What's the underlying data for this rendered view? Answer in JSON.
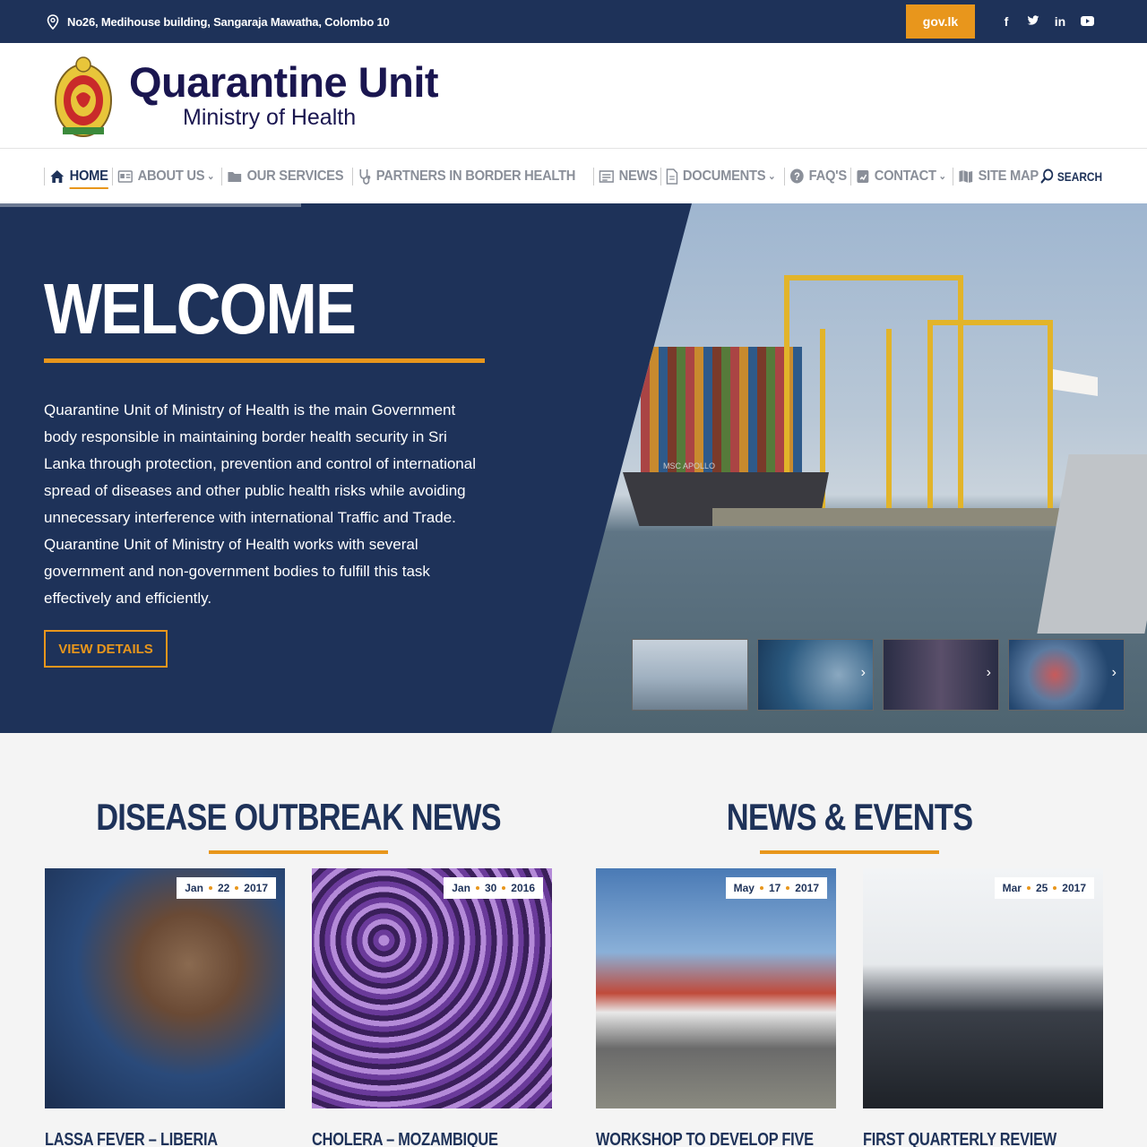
{
  "topbar": {
    "address": "No26, Medihouse building, Sangaraja Mawatha, Colombo 10",
    "gov_label": "gov.lk",
    "social": [
      "f",
      "t",
      "in",
      "yt"
    ]
  },
  "header": {
    "title": "Quarantine Unit",
    "subtitle": "Ministry of Health"
  },
  "nav": {
    "items": [
      {
        "label": "HOME",
        "icon": "home-icon",
        "active": true
      },
      {
        "label": "ABOUT US",
        "icon": "id-card-icon",
        "dropdown": true
      },
      {
        "label": "OUR SERVICES",
        "icon": "folder-icon"
      },
      {
        "label": "PARTNERS IN BORDER HEALTH",
        "icon": "stethoscope-icon"
      },
      {
        "label": "NEWS",
        "icon": "newspaper-icon"
      },
      {
        "label": "DOCUMENTS",
        "icon": "document-icon",
        "dropdown": true
      },
      {
        "label": "FAQ'S",
        "icon": "question-icon"
      },
      {
        "label": "CONTACT",
        "icon": "phone-book-icon",
        "dropdown": true
      },
      {
        "label": "SITE MAP",
        "icon": "map-icon"
      }
    ],
    "search_label": "SEARCH"
  },
  "hero": {
    "title": "WELCOME",
    "text": "Quarantine Unit of Ministry of Health is the main Government body responsible in maintaining border health security in Sri Lanka through protection, prevention and control of international spread of diseases and other public health risks while avoiding unnecessary interference with international Traffic and Trade. Quarantine Unit of Ministry of Health works with several government and non-government bodies to fulfill this task effectively and efficiently.",
    "button": "VIEW DETAILS",
    "ship_name": "MSC APOLLO"
  },
  "sections": {
    "outbreak_title": "DISEASE OUTBREAK NEWS",
    "events_title": "NEWS & EVENTS",
    "cards": [
      {
        "month": "Jan",
        "day": "22",
        "year": "2017",
        "title": "LASSA FEVER – LIBERIA"
      },
      {
        "month": "Jan",
        "day": "30",
        "year": "2016",
        "title": "CHOLERA – MOZAMBIQUE"
      },
      {
        "month": "May",
        "day": "17",
        "year": "2017",
        "title": "WORKSHOP TO DEVELOP FIVE"
      },
      {
        "month": "Mar",
        "day": "25",
        "year": "2017",
        "title": "FIRST QUARTERLY REVIEW"
      }
    ]
  },
  "colors": {
    "navy": "#1e3259",
    "accent": "#e8961c"
  }
}
